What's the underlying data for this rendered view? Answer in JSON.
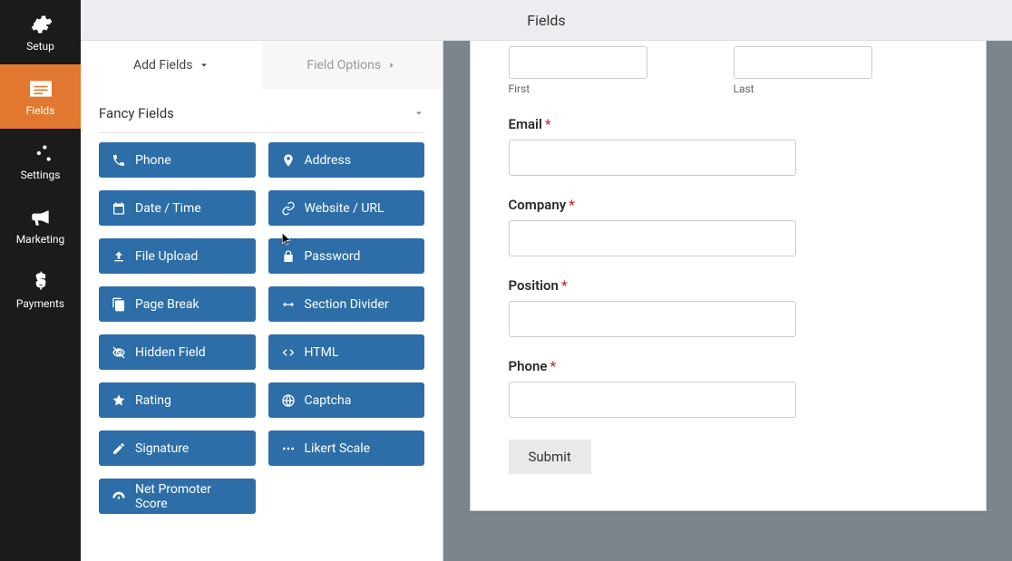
{
  "nav": {
    "items": [
      {
        "label": "Setup",
        "icon": "gear-icon"
      },
      {
        "label": "Fields",
        "icon": "fields-icon",
        "active": true
      },
      {
        "label": "Settings",
        "icon": "sliders-icon"
      },
      {
        "label": "Marketing",
        "icon": "bullhorn-icon"
      },
      {
        "label": "Payments",
        "icon": "dollar-icon"
      }
    ]
  },
  "titlebar": {
    "title": "Fields"
  },
  "tabs": {
    "add_fields": "Add Fields",
    "field_options": "Field Options"
  },
  "fields_panel": {
    "section_title": "Fancy Fields",
    "items": [
      {
        "label": "Phone",
        "icon": "phone-icon"
      },
      {
        "label": "Address",
        "icon": "map-pin-icon"
      },
      {
        "label": "Date / Time",
        "icon": "calendar-icon"
      },
      {
        "label": "Website / URL",
        "icon": "link-icon"
      },
      {
        "label": "File Upload",
        "icon": "upload-icon"
      },
      {
        "label": "Password",
        "icon": "lock-icon"
      },
      {
        "label": "Page Break",
        "icon": "copy-icon"
      },
      {
        "label": "Section Divider",
        "icon": "arrows-h-icon"
      },
      {
        "label": "Hidden Field",
        "icon": "eye-off-icon"
      },
      {
        "label": "HTML",
        "icon": "code-icon"
      },
      {
        "label": "Rating",
        "icon": "star-icon"
      },
      {
        "label": "Captcha",
        "icon": "globe-icon"
      },
      {
        "label": "Signature",
        "icon": "pencil-icon"
      },
      {
        "label": "Likert Scale",
        "icon": "dots-icon"
      },
      {
        "label": "Net Promoter Score",
        "icon": "gauge-icon"
      }
    ]
  },
  "preview": {
    "first_sub": "First",
    "last_sub": "Last",
    "fields": [
      {
        "label": "Email",
        "required": true
      },
      {
        "label": "Company",
        "required": true
      },
      {
        "label": "Position",
        "required": true
      },
      {
        "label": "Phone",
        "required": true
      }
    ],
    "submit": "Submit"
  }
}
